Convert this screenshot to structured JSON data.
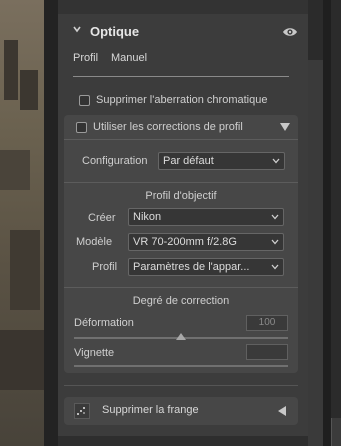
{
  "section": {
    "title": "Optique",
    "icons": {
      "collapse": "chevron-down-icon",
      "visibility": "eye-icon"
    }
  },
  "tabs": [
    {
      "label": "Profil"
    },
    {
      "label": "Manuel"
    }
  ],
  "chromatic_aberration": {
    "label": "Supprimer l'aberration chromatique",
    "checked": false
  },
  "profile_corrections": {
    "label": "Utiliser les corrections de profil",
    "checked": false,
    "configuration": {
      "label": "Configuration",
      "value": "Par défaut"
    },
    "lens_profile_heading": "Profil d'objectif",
    "maker": {
      "label": "Créer",
      "value": "Nikon"
    },
    "model": {
      "label": "Modèle",
      "value": "VR 70-200mm f/2.8G"
    },
    "profile": {
      "label": "Profil",
      "value": "Paramètres de l'appar..."
    },
    "correction_heading": "Degré de correction",
    "distortion": {
      "label": "Déformation",
      "value": "100",
      "amount_pct": 100
    },
    "vignette": {
      "label": "Vignette",
      "value": ""
    }
  },
  "defringe": {
    "label": "Supprimer la frange",
    "icon": "defringe-icon"
  },
  "colors": {
    "panel_bg": "#3c3c3c",
    "group_bg": "#474747",
    "text": "#cfcfcf"
  }
}
